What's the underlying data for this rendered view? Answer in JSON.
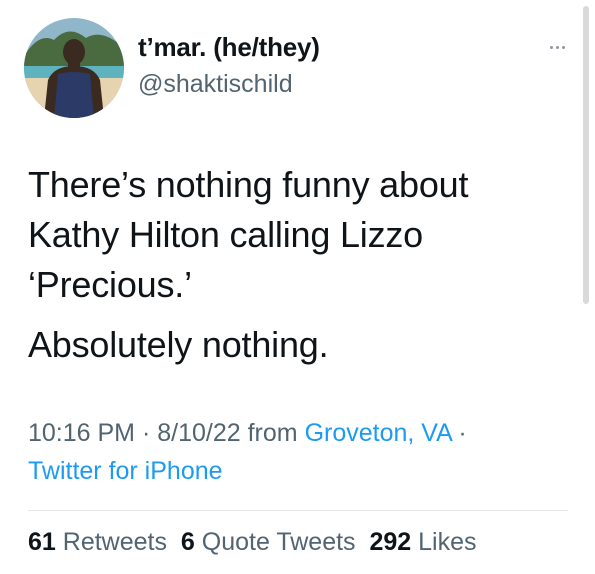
{
  "user": {
    "display_name": "t’mar. (he/they)",
    "handle": "@shaktischild",
    "avatar_icon": "profile-photo"
  },
  "more_icon": "ellipsis-icon",
  "tweet": {
    "paragraphs": [
      "There’s nothing funny about\nKathy Hilton calling Lizzo\n‘Precious.’",
      "Absolutely nothing."
    ]
  },
  "meta": {
    "time": "10:16 PM",
    "sep1": " · ",
    "date": "8/10/22",
    "from_word": " from ",
    "location": "Groveton, VA",
    "sep2": " · ",
    "source": "Twitter for iPhone"
  },
  "stats": {
    "retweets_count": "61",
    "retweets_label": "Retweets",
    "quotes_count": "6",
    "quotes_label": "Quote Tweets",
    "likes_count": "292",
    "likes_label": "Likes"
  },
  "colors": {
    "text": "#0f1419",
    "secondary": "#536471",
    "link": "#1d9bf0"
  }
}
